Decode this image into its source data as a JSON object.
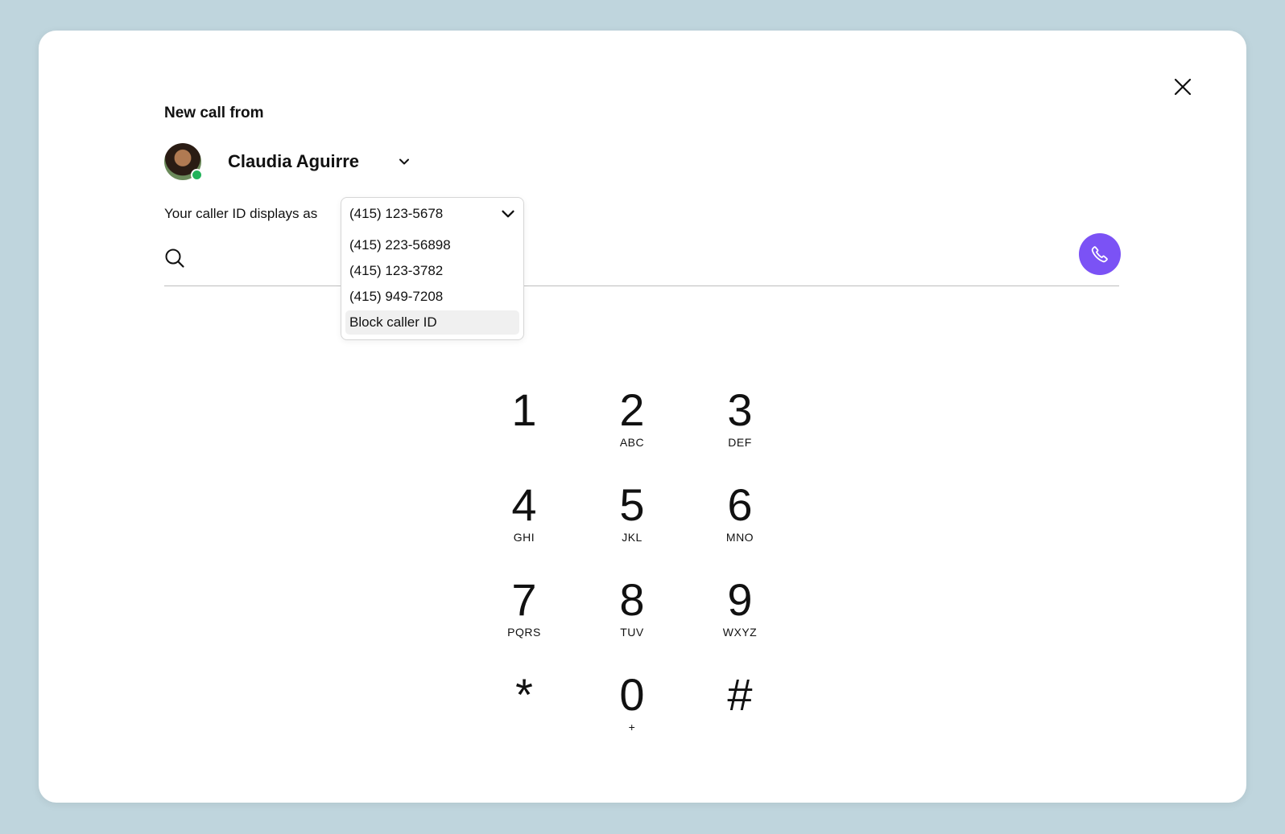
{
  "dialog": {
    "title": "New call from",
    "user_name": "Claudia Aguirre",
    "caller_id_label": "Your caller ID displays as",
    "search_placeholder": "",
    "status_color": "#22b35a",
    "call_button_color": "#7b52f5"
  },
  "caller_id_dropdown": {
    "selected": "(415) 123-5678",
    "options": [
      {
        "label": "(415) 223-56898"
      },
      {
        "label": "(415) 123-3782"
      },
      {
        "label": "(415) 949-7208"
      },
      {
        "label": "Block caller ID",
        "highlighted": true
      }
    ]
  },
  "keypad": [
    {
      "digit": "1",
      "letters": ""
    },
    {
      "digit": "2",
      "letters": "ABC"
    },
    {
      "digit": "3",
      "letters": "DEF"
    },
    {
      "digit": "4",
      "letters": "GHI"
    },
    {
      "digit": "5",
      "letters": "JKL"
    },
    {
      "digit": "6",
      "letters": "MNO"
    },
    {
      "digit": "7",
      "letters": "PQRS"
    },
    {
      "digit": "8",
      "letters": "TUV"
    },
    {
      "digit": "9",
      "letters": "WXYZ"
    },
    {
      "digit": "*",
      "letters": ""
    },
    {
      "digit": "0",
      "letters": "+"
    },
    {
      "digit": "#",
      "letters": ""
    }
  ],
  "icons": [
    "close-icon",
    "chevron-down-icon",
    "search-icon",
    "phone-icon"
  ]
}
